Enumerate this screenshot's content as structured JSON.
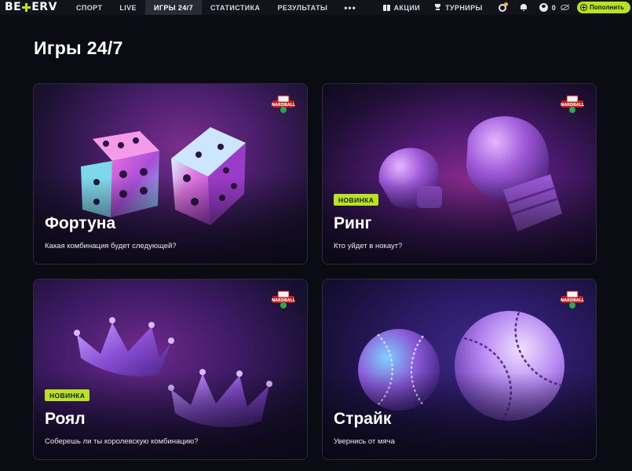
{
  "brand": {
    "logo_left": "BE",
    "logo_right": "ERV"
  },
  "nav": {
    "items": [
      {
        "label": "СПОРТ"
      },
      {
        "label": "LIVE"
      },
      {
        "label": "ИГРЫ 24/7"
      },
      {
        "label": "СТАТИСТИКА"
      },
      {
        "label": "РЕЗУЛЬТАТЫ"
      }
    ],
    "more": "•••",
    "active_index": 2
  },
  "right_nav": {
    "promotions": "АКЦИИ",
    "tournaments": "ТУРНИРЫ",
    "balance": "0",
    "deposit": "Пополнить"
  },
  "page": {
    "title": "Игры 24/7"
  },
  "cards": [
    {
      "title": "Фортуна",
      "subtitle": "Какая комбинация будет следующей?",
      "badge": ""
    },
    {
      "title": "Ринг",
      "subtitle": "Кто уйдет в нокаут?",
      "badge": "НОВИНКА"
    },
    {
      "title": "Роял",
      "subtitle": "Соберешь ли ты королевскую комбинацию?",
      "badge": "НОВИНКА"
    },
    {
      "title": "Страйк",
      "subtitle": "Увернись от мяча",
      "badge": ""
    }
  ],
  "provider": {
    "logo_text": "NARDBALL"
  },
  "colors": {
    "accent": "#b7e322",
    "background": "#0b0b13",
    "nav_bg": "#13131c"
  }
}
